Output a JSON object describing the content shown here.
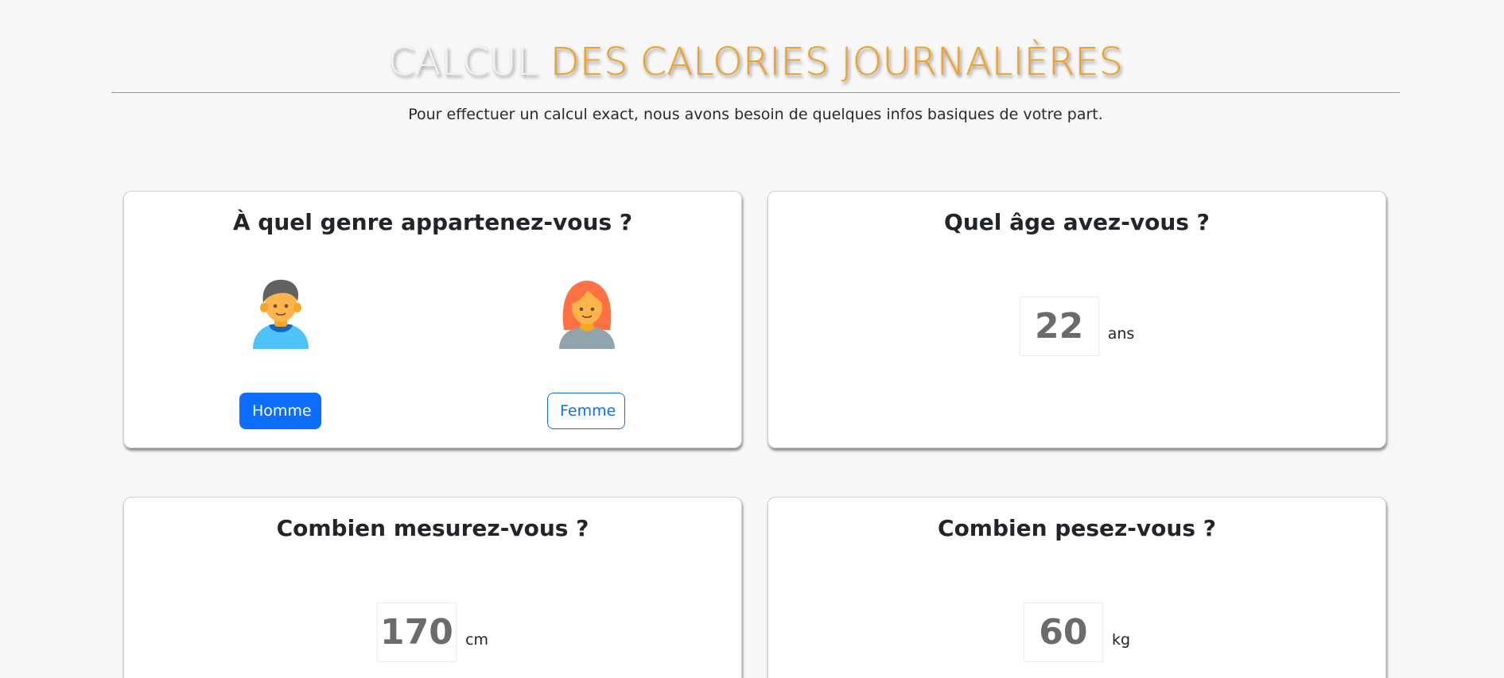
{
  "header": {
    "title_part1": "CALCUL",
    "title_part2": "DES CALORIES JOURNALIÈRES",
    "subtitle": "Pour effectuer un calcul exact, nous avons besoin de quelques infos basiques de votre part."
  },
  "gender": {
    "question": "À quel genre appartenez-vous ?",
    "male_label": "Homme",
    "female_label": "Femme",
    "selected": "Homme"
  },
  "age": {
    "question": "Quel âge avez-vous ?",
    "value": "22",
    "unit": "ans"
  },
  "height": {
    "question": "Combien mesurez-vous ?",
    "value": "170",
    "unit": "cm"
  },
  "weight": {
    "question": "Combien pesez-vous ?",
    "value": "60",
    "unit": "kg"
  },
  "colors": {
    "title_accent": "#f0a227",
    "primary": "#0d6efd",
    "background": "#f7f7f7"
  }
}
